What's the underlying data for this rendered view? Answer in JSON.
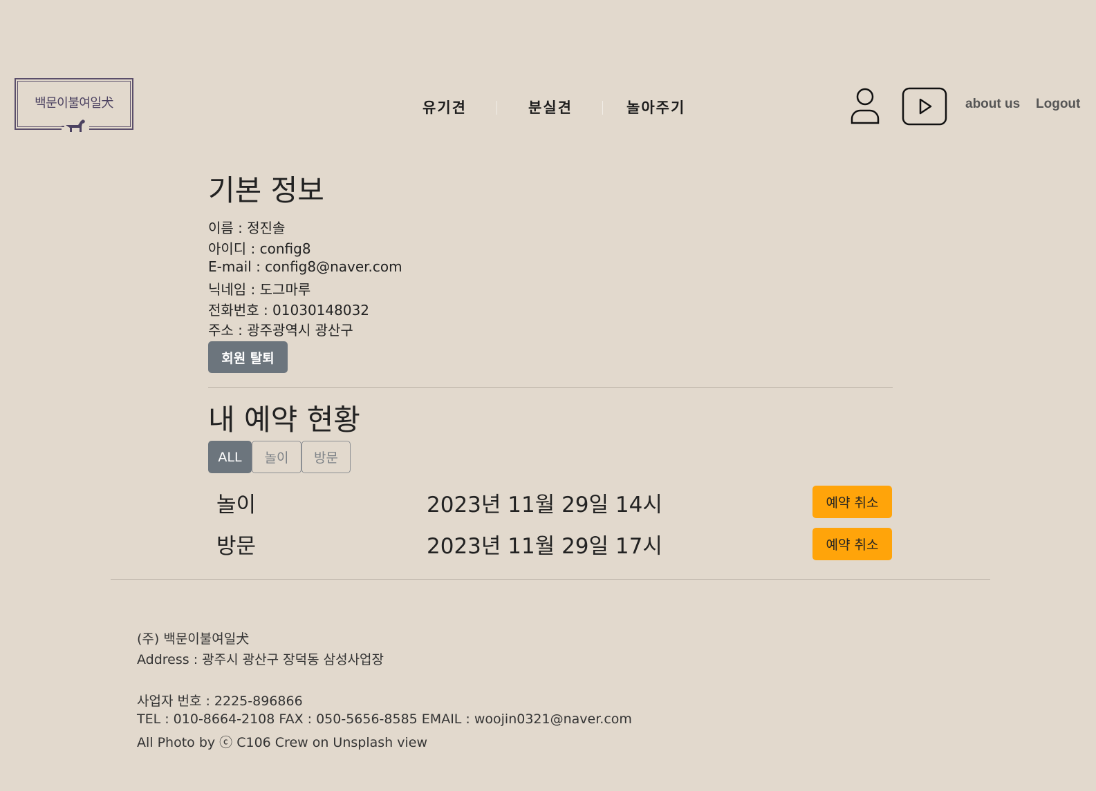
{
  "header": {
    "logo_text": "백문이불여일犬",
    "nav": [
      "유기견",
      "분실견",
      "놀아주기"
    ],
    "about_label": "about us",
    "logout_label": "Logout"
  },
  "basic_info": {
    "title": "기본 정보",
    "lines": [
      "이름 : 정진솔",
      "아이디 : config8",
      "E-mail : config8@naver.com",
      "닉네임 : 도그마루",
      "전화번호 : 01030148032",
      "주소 : 광주광역시 광산구"
    ],
    "withdraw_label": "회원 탈퇴"
  },
  "reservations": {
    "title": "내 예약 현황",
    "filters": [
      "ALL",
      "놀이",
      "방문"
    ],
    "active_filter": "ALL",
    "items": [
      {
        "type": "놀이",
        "datetime": "2023년 11월 29일 14시",
        "cancel_label": "예약 취소"
      },
      {
        "type": "방문",
        "datetime": "2023년 11월 29일 17시",
        "cancel_label": "예약 취소"
      }
    ]
  },
  "footer": {
    "lines": [
      "(주) 백문이불여일犬",
      "Address : 광주시 광산구 장덕동 삼성사업장",
      "사업자 번호 : 2225-896866",
      "TEL : 010-8664-2108 FAX : 050-5656-8585 EMAIL : woojin0321@naver.com",
      "All Photo by ⓒ C106 Crew on Unsplash view"
    ]
  },
  "colors": {
    "background": "#e2d9cd",
    "gray_button": "#6c757d",
    "orange_button": "#ffa40a",
    "logo": "#4b4160"
  },
  "icons": [
    "user-icon",
    "youtube-play-icon",
    "dog-icon"
  ]
}
